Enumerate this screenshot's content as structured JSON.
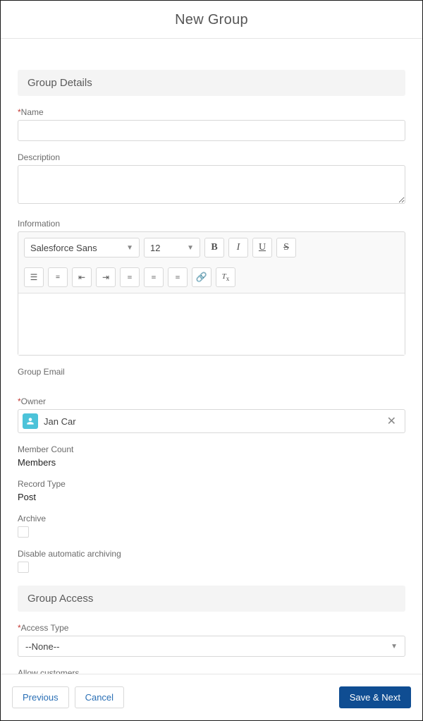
{
  "modal": {
    "title": "New Group"
  },
  "sections": {
    "groupDetails": {
      "header": "Group Details"
    },
    "groupAccess": {
      "header": "Group Access"
    }
  },
  "fields": {
    "name": {
      "label": "Name",
      "required": "*",
      "value": ""
    },
    "description": {
      "label": "Description",
      "value": ""
    },
    "information": {
      "label": "Information",
      "font": "Salesforce Sans",
      "size": "12"
    },
    "groupEmail": {
      "label": "Group Email"
    },
    "owner": {
      "label": "Owner",
      "required": "*",
      "value": "Jan Car"
    },
    "memberCount": {
      "label": "Member Count",
      "value": "Members"
    },
    "recordType": {
      "label": "Record Type",
      "value": "Post"
    },
    "archive": {
      "label": "Archive"
    },
    "disableAutoArchive": {
      "label": "Disable automatic archiving"
    },
    "accessType": {
      "label": "Access Type",
      "required": "*",
      "value": "--None--"
    },
    "allowCustomers": {
      "label": "Allow customers"
    }
  },
  "footer": {
    "previous": "Previous",
    "cancel": "Cancel",
    "saveNext": "Save & Next"
  }
}
